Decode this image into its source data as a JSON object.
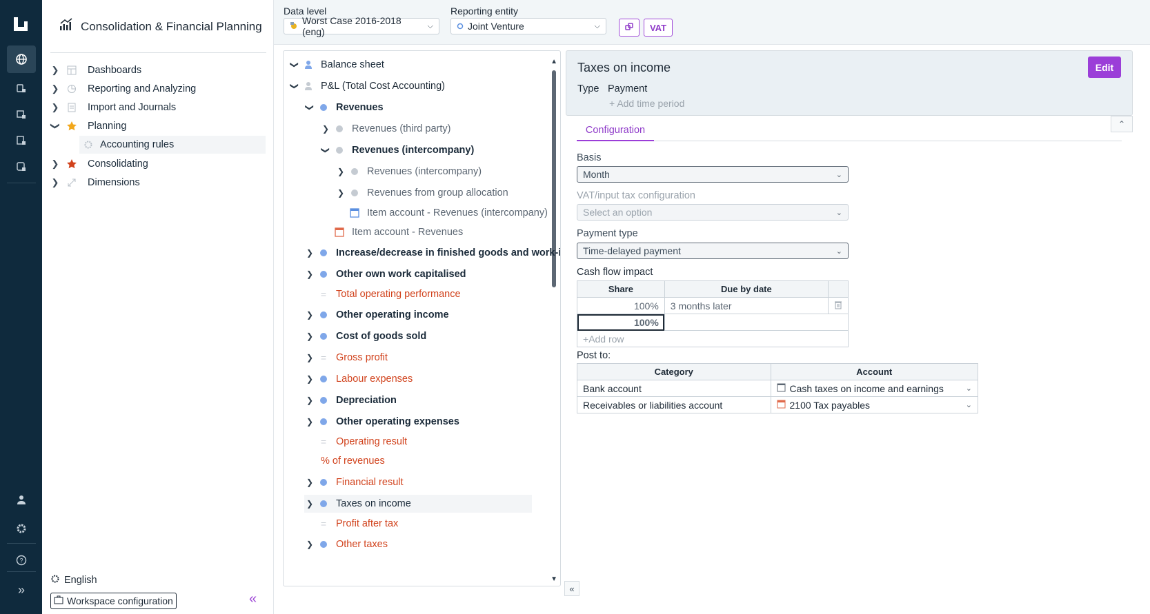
{
  "nav": {
    "app_title": "Consolidation & Financial Planning",
    "items": [
      {
        "label": "Dashboards"
      },
      {
        "label": "Reporting and Analyzing"
      },
      {
        "label": "Import and Journals"
      },
      {
        "label": "Planning"
      },
      {
        "label": "Accounting rules"
      },
      {
        "label": "Consolidating"
      },
      {
        "label": "Dimensions"
      }
    ],
    "language": "English",
    "workspace_button": "Workspace configuration"
  },
  "toolbar": {
    "data_level_label": "Data level",
    "data_level_value": "Worst Case 2016-2018 (eng)",
    "entity_label": "Reporting entity",
    "entity_value": "Joint Venture",
    "vat_button": "VAT"
  },
  "tree": {
    "rows": [
      {
        "label": "Balance sheet"
      },
      {
        "label": "P&L (Total Cost Accounting)"
      },
      {
        "label": "Revenues"
      },
      {
        "label": "Revenues (third party)"
      },
      {
        "label": "Revenues (intercompany)"
      },
      {
        "label": "Revenues (intercompany)"
      },
      {
        "label": "Revenues from group allocation"
      },
      {
        "label": "Item account - Revenues (intercompany)"
      },
      {
        "label": "Item account - Revenues"
      },
      {
        "label": "Increase/decrease in finished goods and work-i..."
      },
      {
        "label": "Other own work capitalised"
      },
      {
        "label": "Total operating performance"
      },
      {
        "label": "Other operating income"
      },
      {
        "label": "Cost of goods sold"
      },
      {
        "label": "Gross profit"
      },
      {
        "label": "Labour expenses"
      },
      {
        "label": "Depreciation"
      },
      {
        "label": "Other operating expenses"
      },
      {
        "label": "Operating result"
      },
      {
        "label": "% of revenues"
      },
      {
        "label": "Financial result"
      },
      {
        "label": "Taxes on income"
      },
      {
        "label": "Profit after tax"
      },
      {
        "label": "Other taxes"
      }
    ]
  },
  "detail": {
    "title": "Taxes on income",
    "type_label": "Type",
    "type_value": "Payment",
    "add_period": "Add time period",
    "edit_button": "Edit",
    "tab": "Configuration",
    "basis_label": "Basis",
    "basis_value": "Month",
    "vat_label": "VAT/input tax configuration",
    "vat_placeholder": "Select an option",
    "payment_type_label": "Payment type",
    "payment_type_value": "Time-delayed payment",
    "cashflow_label": "Cash flow impact",
    "cashflow": {
      "headers": [
        "Share",
        "Due by date"
      ],
      "rows": [
        {
          "share": "100%",
          "due": "3 months later"
        },
        {
          "share": "100%",
          "due": ""
        }
      ],
      "add_row": "Add row"
    },
    "post_to_label": "Post to:",
    "post_to": {
      "headers": [
        "Category",
        "Account"
      ],
      "rows": [
        {
          "category": "Bank account",
          "account": "Cash taxes on income and earnings"
        },
        {
          "category": "Receivables or liabilities account",
          "account": "2100 Tax payables"
        }
      ]
    }
  },
  "colors": {
    "rail": "#0f2a3d",
    "accent": "#9b3ed8",
    "calc_red": "#d1421c",
    "node_blue": "#7fa7e9"
  }
}
